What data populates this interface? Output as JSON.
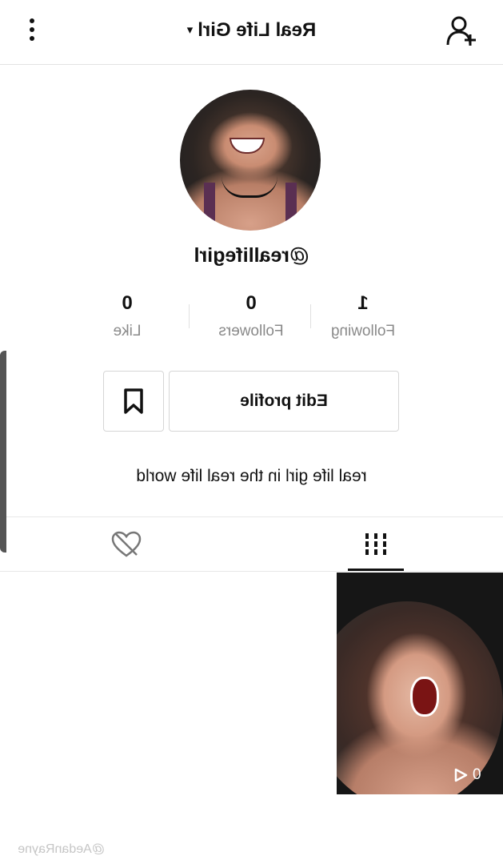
{
  "header": {
    "title": "Real Life Girl",
    "caret": "▾"
  },
  "profile": {
    "username": "@reallifegirl",
    "bio": "real life girl in the real life world"
  },
  "stats": [
    {
      "value": "1",
      "label": "Following"
    },
    {
      "value": "0",
      "label": "Followers"
    },
    {
      "value": "0",
      "label": "Like"
    }
  ],
  "actions": {
    "edit_label": "Edit profile"
  },
  "videos": [
    {
      "views": "0"
    }
  ],
  "watermark": "@AedanRayne",
  "colors": {
    "text": "#111111",
    "secondary": "#8a8a8a",
    "border": "#d6d6d6"
  },
  "icons": [
    "add-user-icon",
    "more-icon",
    "bookmark-icon",
    "grid-icon",
    "liked-hidden-icon",
    "play-icon"
  ]
}
